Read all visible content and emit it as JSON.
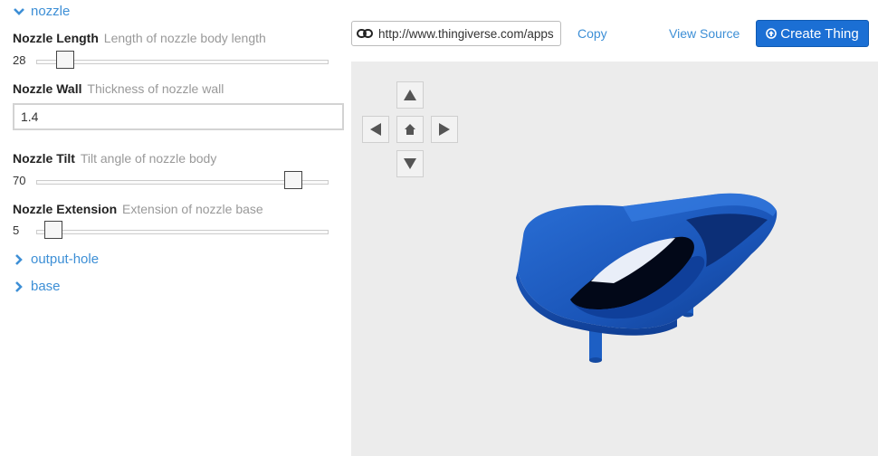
{
  "sidebar": {
    "section_nozzle": "nozzle",
    "params": {
      "length": {
        "name": "Nozzle Length",
        "desc": "Length of nozzle body length",
        "value": "28",
        "slider_fraction": 0.1
      },
      "wall": {
        "name": "Nozzle Wall",
        "desc": "Thickness of nozzle wall",
        "value": "1.4"
      },
      "tilt": {
        "name": "Nozzle Tilt",
        "desc": "Tilt angle of nozzle body",
        "value": "70",
        "slider_fraction": 0.88
      },
      "extension": {
        "name": "Nozzle Extension",
        "desc": "Extension of nozzle base",
        "value": "5",
        "slider_fraction": 0.06
      }
    },
    "section_output_hole": "output-hole",
    "section_base": "base"
  },
  "toolbar": {
    "url": "http://www.thingiverse.com/apps",
    "copy_label": "Copy",
    "view_source_label": "View Source",
    "create_label": "Create Thing"
  },
  "colors": {
    "accent": "#3d8fd6",
    "button": "#1b6fd4",
    "model": "#1d5fc4",
    "viewport_bg": "#ececec"
  }
}
